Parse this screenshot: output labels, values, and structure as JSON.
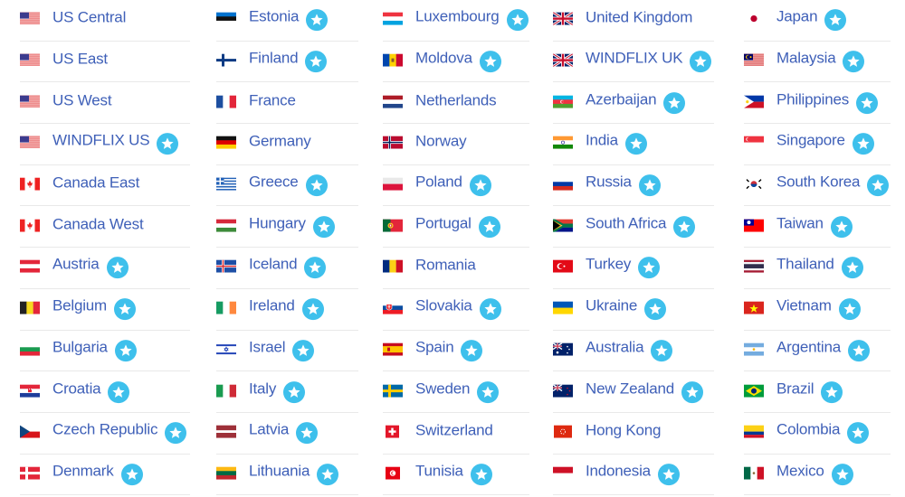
{
  "columns": [
    {
      "items": [
        {
          "label": "US Central",
          "flag": "us",
          "star": false
        },
        {
          "label": "US East",
          "flag": "us",
          "star": false
        },
        {
          "label": "US West",
          "flag": "us",
          "star": false
        },
        {
          "label": "WINDFLIX US",
          "flag": "us",
          "star": true
        },
        {
          "label": "Canada East",
          "flag": "ca",
          "star": false
        },
        {
          "label": "Canada West",
          "flag": "ca",
          "star": false
        },
        {
          "label": "Austria",
          "flag": "at",
          "star": true
        },
        {
          "label": "Belgium",
          "flag": "be",
          "star": true
        },
        {
          "label": "Bulgaria",
          "flag": "bg",
          "star": true
        },
        {
          "label": "Croatia",
          "flag": "hr",
          "star": true
        },
        {
          "label": "Czech Republic",
          "flag": "cz",
          "star": true
        },
        {
          "label": "Denmark",
          "flag": "dk",
          "star": true
        }
      ]
    },
    {
      "items": [
        {
          "label": "Estonia",
          "flag": "ee",
          "star": true
        },
        {
          "label": "Finland",
          "flag": "fi",
          "star": true
        },
        {
          "label": "France",
          "flag": "fr",
          "star": false
        },
        {
          "label": "Germany",
          "flag": "de",
          "star": false
        },
        {
          "label": "Greece",
          "flag": "gr",
          "star": true
        },
        {
          "label": "Hungary",
          "flag": "hu",
          "star": true
        },
        {
          "label": "Iceland",
          "flag": "is",
          "star": true
        },
        {
          "label": "Ireland",
          "flag": "ie",
          "star": true
        },
        {
          "label": "Israel",
          "flag": "il",
          "star": true
        },
        {
          "label": "Italy",
          "flag": "it",
          "star": true
        },
        {
          "label": "Latvia",
          "flag": "lv",
          "star": true
        },
        {
          "label": "Lithuania",
          "flag": "lt",
          "star": true
        }
      ]
    },
    {
      "items": [
        {
          "label": "Luxembourg",
          "flag": "lu",
          "star": true
        },
        {
          "label": "Moldova",
          "flag": "md",
          "star": true
        },
        {
          "label": "Netherlands",
          "flag": "nl",
          "star": false
        },
        {
          "label": "Norway",
          "flag": "no",
          "star": false
        },
        {
          "label": "Poland",
          "flag": "pl",
          "star": true
        },
        {
          "label": "Portugal",
          "flag": "pt",
          "star": true
        },
        {
          "label": "Romania",
          "flag": "ro",
          "star": false
        },
        {
          "label": "Slovakia",
          "flag": "sk",
          "star": true
        },
        {
          "label": "Spain",
          "flag": "es",
          "star": true
        },
        {
          "label": "Sweden",
          "flag": "se",
          "star": true
        },
        {
          "label": "Switzerland",
          "flag": "ch",
          "star": false
        },
        {
          "label": "Tunisia",
          "flag": "tn",
          "star": true
        }
      ]
    },
    {
      "items": [
        {
          "label": "United Kingdom",
          "flag": "gb",
          "star": false
        },
        {
          "label": "WINDFLIX UK",
          "flag": "gb",
          "star": true
        },
        {
          "label": "Azerbaijan",
          "flag": "az",
          "star": true
        },
        {
          "label": "India",
          "flag": "in",
          "star": true
        },
        {
          "label": "Russia",
          "flag": "ru",
          "star": true
        },
        {
          "label": "South Africa",
          "flag": "za",
          "star": true
        },
        {
          "label": "Turkey",
          "flag": "tr",
          "star": true
        },
        {
          "label": "Ukraine",
          "flag": "ua",
          "star": true
        },
        {
          "label": "Australia",
          "flag": "au",
          "star": true
        },
        {
          "label": "New Zealand",
          "flag": "nz",
          "star": true
        },
        {
          "label": "Hong Kong",
          "flag": "hk",
          "star": false
        },
        {
          "label": "Indonesia",
          "flag": "id",
          "star": true
        }
      ]
    },
    {
      "items": [
        {
          "label": "Japan",
          "flag": "jp",
          "star": true
        },
        {
          "label": "Malaysia",
          "flag": "my",
          "star": true
        },
        {
          "label": "Philippines",
          "flag": "ph",
          "star": true
        },
        {
          "label": "Singapore",
          "flag": "sg",
          "star": true
        },
        {
          "label": "South Korea",
          "flag": "kr",
          "star": true
        },
        {
          "label": "Taiwan",
          "flag": "tw",
          "star": true
        },
        {
          "label": "Thailand",
          "flag": "th",
          "star": true
        },
        {
          "label": "Vietnam",
          "flag": "vn",
          "star": true
        },
        {
          "label": "Argentina",
          "flag": "ar",
          "star": true
        },
        {
          "label": "Brazil",
          "flag": "br",
          "star": true
        },
        {
          "label": "Colombia",
          "flag": "co",
          "star": true
        },
        {
          "label": "Mexico",
          "flag": "mx",
          "star": true
        }
      ]
    }
  ],
  "colors": {
    "label": "#3f60b8",
    "star_badge": "#3ec0ec",
    "divider": "#e9e9e9"
  },
  "star_icon": "star-icon"
}
